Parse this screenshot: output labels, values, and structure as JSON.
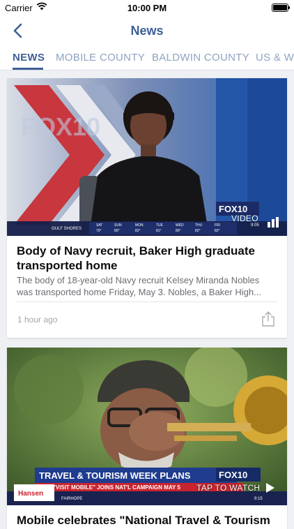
{
  "status_bar": {
    "carrier": "Carrier",
    "time": "10:00 PM"
  },
  "nav": {
    "title": "News"
  },
  "tabs": [
    {
      "label": "NEWS",
      "active": true
    },
    {
      "label": "MOBILE COUNTY",
      "active": false
    },
    {
      "label": "BALDWIN COUNTY",
      "active": false
    },
    {
      "label": "US & WO",
      "active": false
    }
  ],
  "articles": [
    {
      "headline": "Body of Navy recruit, Baker High graduate transported home",
      "summary": "The body of 18-year-old Navy recruit Kelsey Miranda Nobles was transported home Friday, May 3. Nobles, a Baker High...",
      "time_ago": "1 hour ago",
      "media_label": "VIDEO",
      "thumb_text": {
        "station": "FOX10",
        "location": "GULF SHORES",
        "days": [
          "SAT",
          "SUN",
          "MON",
          "TUE",
          "WED",
          "THU",
          "FRI"
        ],
        "temps": [
          "79°",
          "80°",
          "82°",
          "81°",
          "80°",
          "82°",
          "82°"
        ],
        "clock": "9:05"
      }
    },
    {
      "headline": "Mobile celebrates \"National Travel & Tourism",
      "media_label": "TAP TO WATCH",
      "thumb_text": {
        "station": "FOX10",
        "banner_title": "TRAVEL & TOURISM WEEK PLANS",
        "banner_sub": "\"VISIT MOBILE\" JOINS NAT'L CAMPAIGN MAY 5",
        "location": "FAIRHOPE",
        "sponsor": "Hansen",
        "clock": "9:15"
      }
    }
  ],
  "colors": {
    "accent": "#3e5f96",
    "inactive_tab": "#8fa3c2",
    "background": "#eef0f3"
  }
}
